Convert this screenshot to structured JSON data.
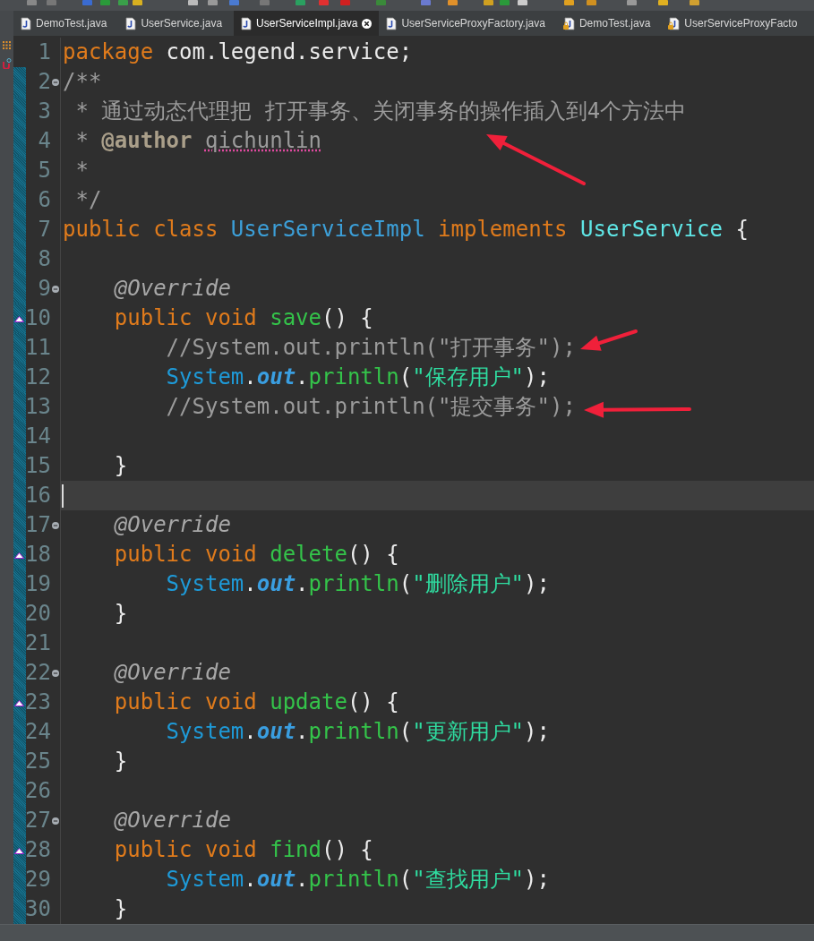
{
  "tabs": [
    {
      "label": "DemoTest.java",
      "selected": false,
      "locked": false
    },
    {
      "label": "UserService.java",
      "selected": false,
      "locked": false
    },
    {
      "label": "UserServiceImpl.java",
      "selected": true,
      "locked": false
    },
    {
      "label": "UserServiceProxyFactory.java",
      "selected": false,
      "locked": false
    },
    {
      "label": "DemoTest.java",
      "selected": false,
      "locked": true
    },
    {
      "label": "UserServiceProxyFacto",
      "selected": false,
      "locked": true
    }
  ],
  "lines": [
    {
      "number": "1",
      "changed": false,
      "foldable": false,
      "override": false,
      "current": false,
      "tokens": [
        {
          "kind": "keyword",
          "text": "package"
        },
        {
          "kind": "plain",
          "text": " com.legend.service;"
        }
      ]
    },
    {
      "number": "2",
      "changed": true,
      "foldable": true,
      "override": false,
      "current": false,
      "tokens": [
        {
          "kind": "comment",
          "text": "/**"
        }
      ]
    },
    {
      "number": "3",
      "changed": true,
      "foldable": false,
      "override": false,
      "current": false,
      "tokens": [
        {
          "kind": "comment",
          "text": " * 通过动态代理把 打开事务、关闭事务的操作插入到4个方法中"
        }
      ]
    },
    {
      "number": "4",
      "changed": true,
      "foldable": false,
      "override": false,
      "current": false,
      "tokens": [
        {
          "kind": "comment",
          "text": " * "
        },
        {
          "kind": "doc-tag",
          "text": "@author "
        },
        {
          "kind": "misspelled",
          "text": "qichunlin"
        }
      ]
    },
    {
      "number": "5",
      "changed": true,
      "foldable": false,
      "override": false,
      "current": false,
      "tokens": [
        {
          "kind": "comment",
          "text": " *"
        }
      ]
    },
    {
      "number": "6",
      "changed": true,
      "foldable": false,
      "override": false,
      "current": false,
      "tokens": [
        {
          "kind": "comment",
          "text": " */"
        }
      ]
    },
    {
      "number": "7",
      "changed": true,
      "foldable": false,
      "override": false,
      "current": false,
      "tokens": [
        {
          "kind": "keyword",
          "text": "public class "
        },
        {
          "kind": "class-name",
          "text": "UserServiceImpl"
        },
        {
          "kind": "keyword",
          "text": " implements "
        },
        {
          "kind": "interface-name",
          "text": "UserService"
        },
        {
          "kind": "plain",
          "text": " {"
        }
      ]
    },
    {
      "number": "8",
      "changed": true,
      "foldable": false,
      "override": false,
      "current": false
    },
    {
      "number": "9",
      "changed": true,
      "foldable": true,
      "override": false,
      "current": false,
      "tokens": [
        {
          "kind": "annotation",
          "text": "    @Override"
        }
      ]
    },
    {
      "number": "10",
      "changed": true,
      "foldable": false,
      "override": true,
      "current": false,
      "tokens": [
        {
          "kind": "keyword",
          "text": "    public void "
        },
        {
          "kind": "method",
          "text": "save"
        },
        {
          "kind": "plain",
          "text": "() {"
        }
      ]
    },
    {
      "number": "11",
      "changed": true,
      "foldable": false,
      "override": false,
      "current": false,
      "tokens": [
        {
          "kind": "comment",
          "text": "        //System.out.println(\"打开事务\");"
        }
      ]
    },
    {
      "number": "12",
      "changed": true,
      "foldable": false,
      "override": false,
      "current": false,
      "tokens": [
        {
          "kind": "system-type",
          "text": "        System"
        },
        {
          "kind": "plain",
          "text": "."
        },
        {
          "kind": "static-field",
          "text": "out"
        },
        {
          "kind": "plain",
          "text": "."
        },
        {
          "kind": "method",
          "text": "println"
        },
        {
          "kind": "plain",
          "text": "("
        },
        {
          "kind": "string",
          "text": "\"保存用户\""
        },
        {
          "kind": "plain",
          "text": ");"
        }
      ]
    },
    {
      "number": "13",
      "changed": true,
      "foldable": false,
      "override": false,
      "current": false,
      "tokens": [
        {
          "kind": "comment",
          "text": "        //System.out.println(\"提交事务\");"
        }
      ]
    },
    {
      "number": "14",
      "changed": true,
      "foldable": false,
      "override": false,
      "current": false
    },
    {
      "number": "15",
      "changed": true,
      "foldable": false,
      "override": false,
      "current": false,
      "tokens": [
        {
          "kind": "plain",
          "text": "    }"
        }
      ]
    },
    {
      "number": "16",
      "changed": true,
      "foldable": false,
      "override": false,
      "current": true
    },
    {
      "number": "17",
      "changed": true,
      "foldable": true,
      "override": false,
      "current": false,
      "tokens": [
        {
          "kind": "annotation",
          "text": "    @Override"
        }
      ]
    },
    {
      "number": "18",
      "changed": true,
      "foldable": false,
      "override": true,
      "current": false,
      "tokens": [
        {
          "kind": "keyword",
          "text": "    public void "
        },
        {
          "kind": "method",
          "text": "delete"
        },
        {
          "kind": "plain",
          "text": "() {"
        }
      ]
    },
    {
      "number": "19",
      "changed": true,
      "foldable": false,
      "override": false,
      "current": false,
      "tokens": [
        {
          "kind": "system-type",
          "text": "        System"
        },
        {
          "kind": "plain",
          "text": "."
        },
        {
          "kind": "static-field",
          "text": "out"
        },
        {
          "kind": "plain",
          "text": "."
        },
        {
          "kind": "method",
          "text": "println"
        },
        {
          "kind": "plain",
          "text": "("
        },
        {
          "kind": "string",
          "text": "\"删除用户\""
        },
        {
          "kind": "plain",
          "text": ");"
        }
      ]
    },
    {
      "number": "20",
      "changed": true,
      "foldable": false,
      "override": false,
      "current": false,
      "tokens": [
        {
          "kind": "plain",
          "text": "    }"
        }
      ]
    },
    {
      "number": "21",
      "changed": true,
      "foldable": false,
      "override": false,
      "current": false
    },
    {
      "number": "22",
      "changed": true,
      "foldable": true,
      "override": false,
      "current": false,
      "tokens": [
        {
          "kind": "annotation",
          "text": "    @Override"
        }
      ]
    },
    {
      "number": "23",
      "changed": true,
      "foldable": false,
      "override": true,
      "current": false,
      "tokens": [
        {
          "kind": "keyword",
          "text": "    public void "
        },
        {
          "kind": "method",
          "text": "update"
        },
        {
          "kind": "plain",
          "text": "() {"
        }
      ]
    },
    {
      "number": "24",
      "changed": true,
      "foldable": false,
      "override": false,
      "current": false,
      "tokens": [
        {
          "kind": "system-type",
          "text": "        System"
        },
        {
          "kind": "plain",
          "text": "."
        },
        {
          "kind": "static-field",
          "text": "out"
        },
        {
          "kind": "plain",
          "text": "."
        },
        {
          "kind": "method",
          "text": "println"
        },
        {
          "kind": "plain",
          "text": "("
        },
        {
          "kind": "string",
          "text": "\"更新用户\""
        },
        {
          "kind": "plain",
          "text": ");"
        }
      ]
    },
    {
      "number": "25",
      "changed": true,
      "foldable": false,
      "override": false,
      "current": false,
      "tokens": [
        {
          "kind": "plain",
          "text": "    }"
        }
      ]
    },
    {
      "number": "26",
      "changed": true,
      "foldable": false,
      "override": false,
      "current": false
    },
    {
      "number": "27",
      "changed": true,
      "foldable": true,
      "override": false,
      "current": false,
      "tokens": [
        {
          "kind": "annotation",
          "text": "    @Override"
        }
      ]
    },
    {
      "number": "28",
      "changed": true,
      "foldable": false,
      "override": true,
      "current": false,
      "tokens": [
        {
          "kind": "keyword",
          "text": "    public void "
        },
        {
          "kind": "method",
          "text": "find"
        },
        {
          "kind": "plain",
          "text": "() {"
        }
      ]
    },
    {
      "number": "29",
      "changed": true,
      "foldable": false,
      "override": false,
      "current": false,
      "tokens": [
        {
          "kind": "system-type",
          "text": "        System"
        },
        {
          "kind": "plain",
          "text": "."
        },
        {
          "kind": "static-field",
          "text": "out"
        },
        {
          "kind": "plain",
          "text": "."
        },
        {
          "kind": "method",
          "text": "println"
        },
        {
          "kind": "plain",
          "text": "("
        },
        {
          "kind": "string",
          "text": "\"查找用户\""
        },
        {
          "kind": "plain",
          "text": ");"
        }
      ]
    },
    {
      "number": "30",
      "changed": true,
      "foldable": false,
      "override": false,
      "current": false,
      "tokens": [
        {
          "kind": "plain",
          "text": "    }"
        }
      ]
    }
  ]
}
